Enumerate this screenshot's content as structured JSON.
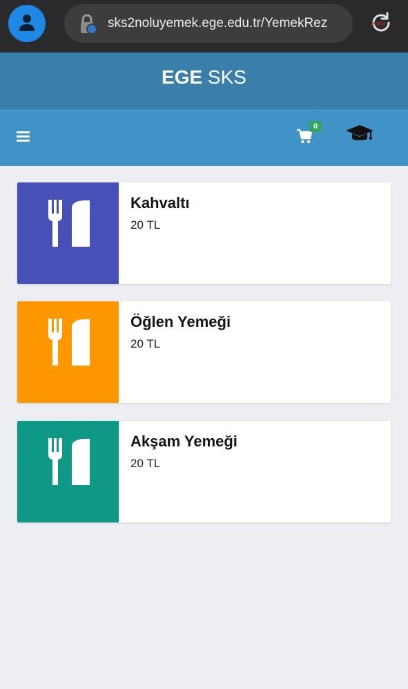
{
  "browser": {
    "url": "sks2noluyemek.ege.edu.tr/YemekRez",
    "watermark": "anka"
  },
  "header": {
    "brand_strong": "EGE",
    "brand_rest": " SKS"
  },
  "nav": {
    "cart_count": "0"
  },
  "meals": [
    {
      "title": "Kahvaltı",
      "price": "20 TL",
      "color": "#4650b7"
    },
    {
      "title": "Öğlen Yemeği",
      "price": "20 TL",
      "color": "#ff9800"
    },
    {
      "title": "Akşam Yemeği",
      "price": "20 TL",
      "color": "#109887"
    }
  ],
  "colors": {
    "browser_bar": "#2a2a2c",
    "brand_bar": "#3a7eaa",
    "nav_bar": "#4193c7",
    "badge": "#2fa65a",
    "page_bg": "#eceef2"
  }
}
